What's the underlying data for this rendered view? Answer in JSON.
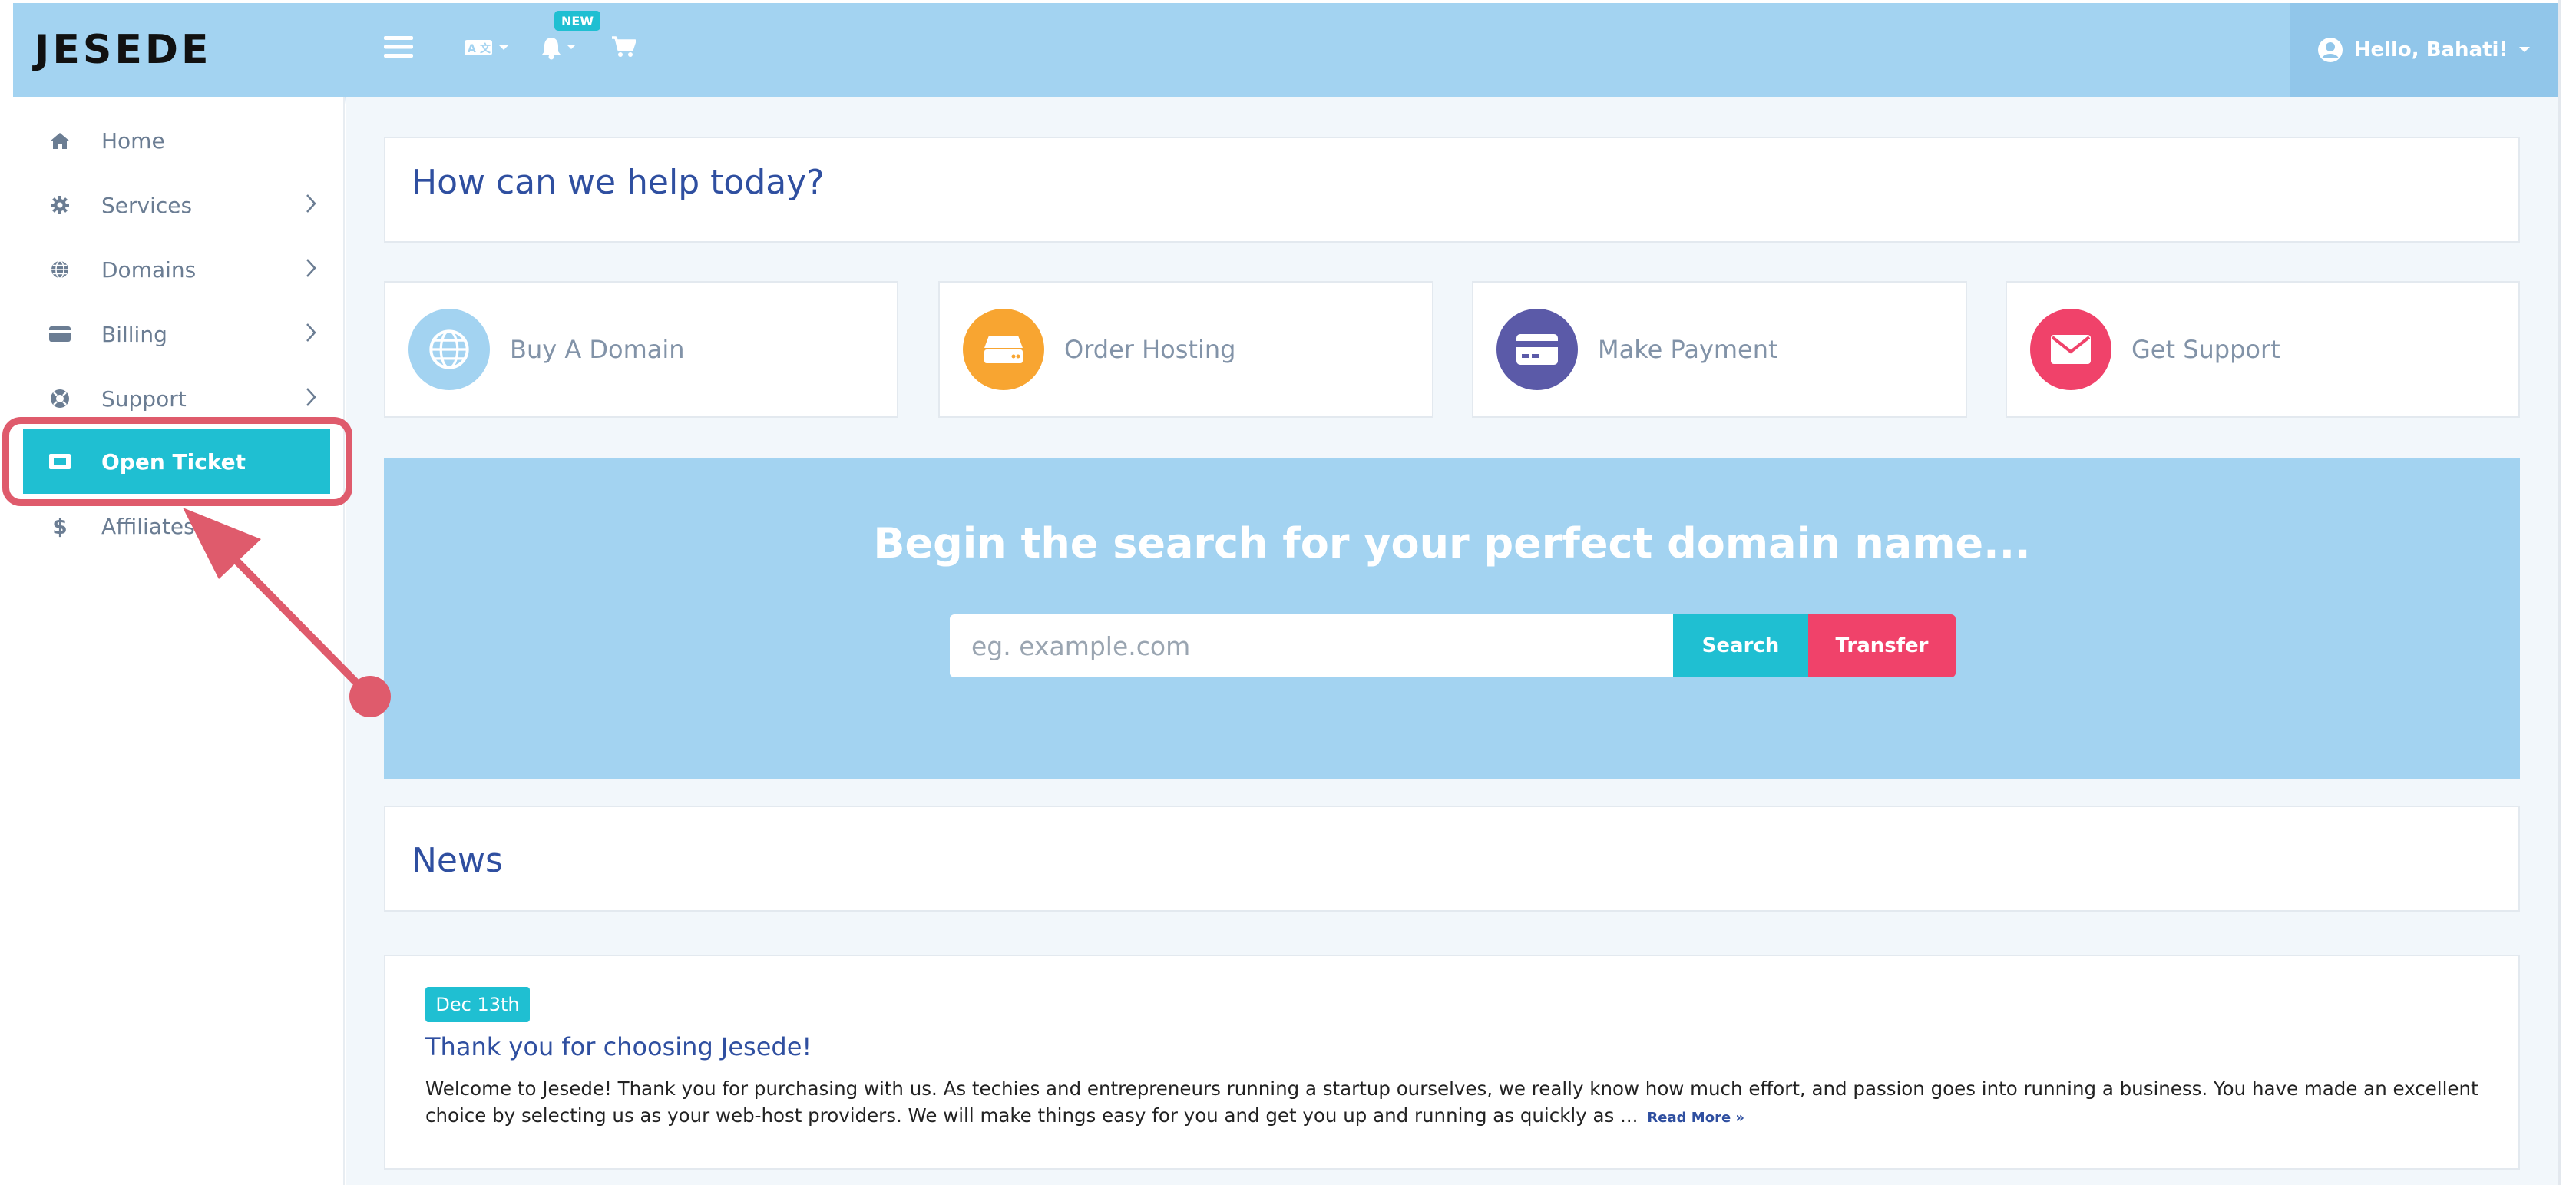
{
  "brand": {
    "logo_text": "JESEDE"
  },
  "topbar": {
    "new_badge": "NEW",
    "user_greeting": "Hello, Bahati!",
    "icons": [
      "menu-icon",
      "language-icon",
      "bell-icon",
      "cart-icon",
      "user-circle-icon"
    ]
  },
  "sidebar": {
    "items": [
      {
        "label": "Home",
        "icon": "home-icon",
        "has_submenu": false
      },
      {
        "label": "Services",
        "icon": "gear-icon",
        "has_submenu": true
      },
      {
        "label": "Domains",
        "icon": "globe-icon",
        "has_submenu": true
      },
      {
        "label": "Billing",
        "icon": "credit-card-icon",
        "has_submenu": true
      },
      {
        "label": "Support",
        "icon": "lifebuoy-icon",
        "has_submenu": true
      },
      {
        "label": "Open Ticket",
        "icon": "ticket-icon",
        "has_submenu": false,
        "active": true
      },
      {
        "label": "Affiliates",
        "icon": "dollar-icon",
        "has_submenu": false
      }
    ]
  },
  "main": {
    "help_title": "How can we help today?",
    "quick_actions": [
      {
        "label": "Buy A Domain",
        "icon": "globe-icon",
        "color": "#a3d3f1"
      },
      {
        "label": "Order Hosting",
        "icon": "server-icon",
        "color": "#f8a531"
      },
      {
        "label": "Make Payment",
        "icon": "credit-card-icon",
        "color": "#5b5aa8"
      },
      {
        "label": "Get Support",
        "icon": "envelope-icon",
        "color": "#f0426a"
      }
    ],
    "domain_search": {
      "title": "Begin the search for your perfect domain name...",
      "placeholder": "eg. example.com",
      "search_label": "Search",
      "transfer_label": "Transfer"
    },
    "news": {
      "title": "News",
      "posts": [
        {
          "date": "Dec 13th",
          "title": "Thank you for choosing Jesede!",
          "body": "Welcome to Jesede!   Thank you for purchasing with us. As techies and entrepreneurs running a startup ourselves, we really know how much effort, and passion goes into running a business. You have made an excellent choice by selecting us as your web-host providers. We will make things easy for you and get you up and running as quickly as ...",
          "read_more": "Read More »"
        }
      ]
    }
  },
  "colors": {
    "header_bg": "#a3d3f1",
    "accent_teal": "#1fbfd2",
    "accent_red": "#f0426a",
    "annotation_red": "#df5b6c",
    "heading_blue": "#2f4fa0"
  }
}
